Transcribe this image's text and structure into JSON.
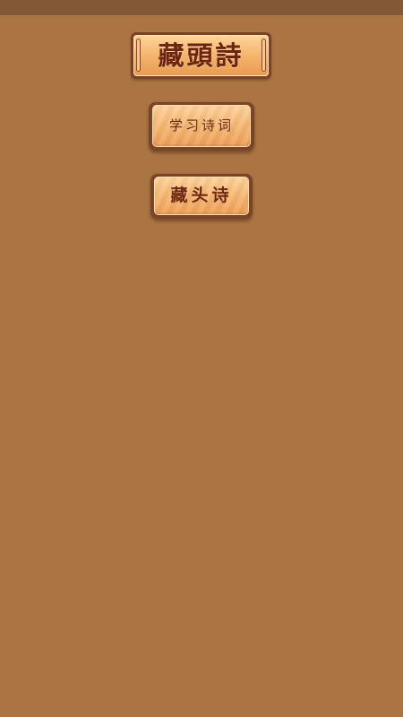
{
  "title": "藏頭詩",
  "buttons": {
    "study_label": "学习诗词",
    "acrostic_label": "藏头诗"
  },
  "colors": {
    "background": "#ab7443",
    "status_bar": "#815838",
    "plaque_frame": "#7b4326",
    "plaque_face": "#f3b26a",
    "text": "#6a2411"
  }
}
